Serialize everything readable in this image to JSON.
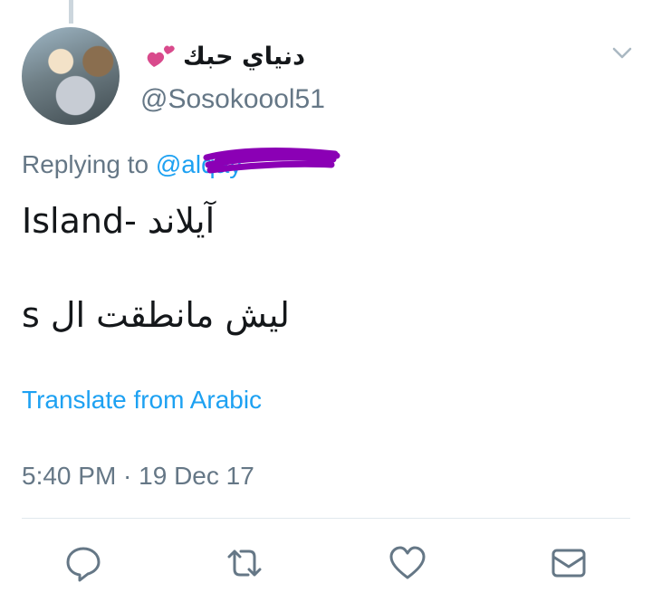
{
  "tweet": {
    "display_name": "دنياي حبك",
    "emoji_icon": "two-hearts-icon",
    "handle": "@Sosokoool51",
    "replying_label": "Replying to",
    "replying_to": "@alqay",
    "text_line1": "آيلاند -Island",
    "text_line2": "ليش مانطقت ال s",
    "translate_label": "Translate from Arabic",
    "timestamp": "5:40 PM · 19 Dec 17"
  },
  "actions": [
    {
      "name": "reply",
      "icon": "reply-icon"
    },
    {
      "name": "retweet",
      "icon": "retweet-icon"
    },
    {
      "name": "like",
      "icon": "heart-icon"
    },
    {
      "name": "direct-message",
      "icon": "envelope-icon"
    }
  ],
  "colors": {
    "accent": "#1da1f2",
    "muted": "#657786",
    "text": "#14171a",
    "redaction": "#8b00b5",
    "emoji": "#d94a8c"
  }
}
